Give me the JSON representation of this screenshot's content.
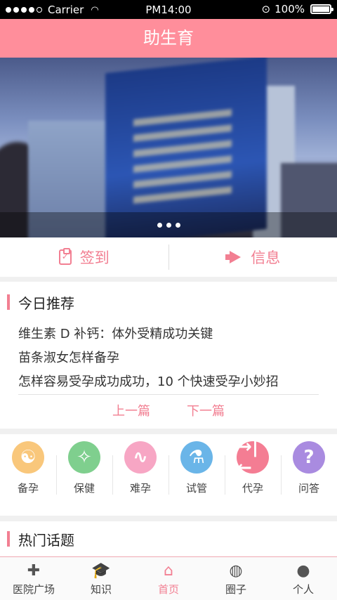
{
  "status": {
    "carrier": "Carrier",
    "time": "PM14:00",
    "battery": "100%"
  },
  "header": {
    "title": "助生育"
  },
  "actions": {
    "checkin": "签到",
    "message": "信息"
  },
  "recommend": {
    "title": "今日推荐",
    "items": [
      "维生素 D 补钙：体外受精成功关键",
      "苗条淑女怎样备孕",
      "怎样容易受孕成功成功，10 个快速受孕小妙招"
    ],
    "prev": "上一篇",
    "next": "下一篇"
  },
  "categories": [
    {
      "label": "备孕",
      "icon": "yin-yang-icon",
      "color": "#f9c77b"
    },
    {
      "label": "保健",
      "icon": "exercise-icon",
      "color": "#7fcf8e"
    },
    {
      "label": "难孕",
      "icon": "pulse-icon",
      "color": "#f7a6c4"
    },
    {
      "label": "试管",
      "icon": "flask-icon",
      "color": "#6ab5e8"
    },
    {
      "label": "代孕",
      "icon": "arrows-inward-icon",
      "color": "#f47d93"
    },
    {
      "label": "问答",
      "icon": "question-icon",
      "color": "#a98be0"
    }
  ],
  "hot": {
    "title": "热门话题"
  },
  "tabs": [
    {
      "label": "医院广场",
      "icon": "location-plus-icon"
    },
    {
      "label": "知识",
      "icon": "graduation-cap-icon"
    },
    {
      "label": "首页",
      "icon": "home-icon"
    },
    {
      "label": "圈子",
      "icon": "planet-icon"
    },
    {
      "label": "个人",
      "icon": "person-icon"
    }
  ],
  "active_tab": "首页",
  "colors": {
    "accent": "#f27f92",
    "header": "#ff8e9b"
  }
}
